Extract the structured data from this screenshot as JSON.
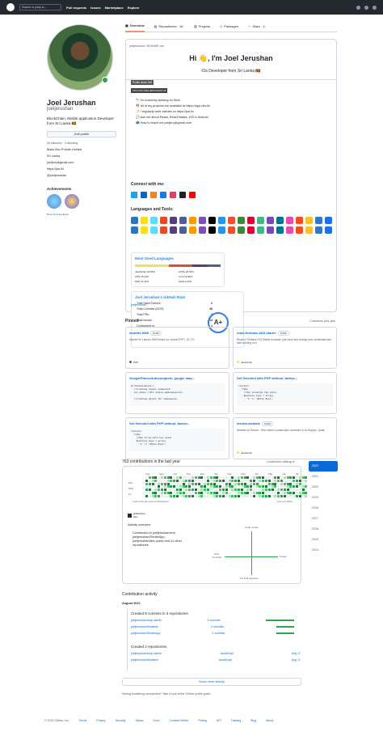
{
  "header": {
    "search_placeholder": "Search or jump to...",
    "nav": [
      "Pull requests",
      "Issues",
      "Marketplace",
      "Explore"
    ]
  },
  "tabs": [
    {
      "label": "Overview",
      "count": ""
    },
    {
      "label": "Repositories",
      "count": "78"
    },
    {
      "label": "Projects",
      "count": ""
    },
    {
      "label": "Packages",
      "count": ""
    },
    {
      "label": "Stars",
      "count": "7"
    }
  ],
  "profile": {
    "name": "Joel Jerushan",
    "username": "joeljerushan",
    "bio": "BlockChain, Mobile application Developer from Sri Lanka 🇱🇰",
    "edit_label": "Edit profile",
    "follow_text": "28 followers · 0 following",
    "details": [
      "Black Box Private Limited",
      "Sri Lanka",
      "joeljeru@gmail.com",
      "https://jse.lk/",
      "@joeljerushan"
    ],
    "achievements_title": "Achievements",
    "beta_text": "Beta  Send feedback"
  },
  "readme": {
    "path": "joeljerushan / README.md",
    "title": "Hi 👋, I'm Joel Jerushan",
    "subtitle": "iOs Developer from Sri Lanka 🇱🇰",
    "profile_views": "Profile views 318",
    "follow_badge": "FOLLOW JOELJERUSHAN 18",
    "bullets": [
      "🔭 I'm currently working on Slick",
      "👯 All of my projects are available at https://app-dev.lk/",
      "📝 I regularly write articles on https://jse.lk/",
      "💬 Ask me about React, React Native, iOS & Android",
      "📫 How to reach me joeljeru@gmail.com"
    ],
    "connect_title": "Connect with me:",
    "languages_title": "Languages and Tools:",
    "most_used": "Most Used Languages",
    "languages": [
      "JavaScript 40.96%",
      "HTML 26.64%",
      "CSS 18.23%",
      "Less 12.82%",
      "PHP 14.12%",
      "Hack 0.23%"
    ],
    "stats_title": "Joel Jerushan's GitHub Stats",
    "stats": [
      {
        "label": "Total Stars Earned:",
        "value": "2"
      },
      {
        "label": "Total Commits (2022):",
        "value": "26"
      },
      {
        "label": "Total PRs:",
        "value": "3"
      },
      {
        "label": "Total Issues:",
        "value": "14"
      },
      {
        "label": "Contributed to:",
        "value": "1"
      }
    ],
    "grade": "A+",
    "image_alt": "joeljerushan"
  },
  "pinned": {
    "title": "Pinned",
    "customize": "Customize your pins",
    "items": [
      {
        "title": "mobitel-SMS",
        "visibility": "Public",
        "desc": "Mobitel Sri Lanka's SMS library for Laravel PHP | JS | TS",
        "code": "",
        "lang": "PHP"
      },
      {
        "title": "react-firebase-iotS-starter",
        "visibility": "Public",
        "desc": "React & Firebase IOS Starter template, just clone and change your credentials and start working on it",
        "code": "",
        "lang": "JavaScript"
      },
      {
        "title": "GooglePlacesAutocomplete, google map...",
        "visibility": "",
        "desc": "",
        "code": "$('#placesInput').\n  //creating places component\n  let place = Rtl.statuc.addcomponents\n\n  //creating object for namespaces",
        "lang": ""
      },
      {
        "title": "Set Selected with PHP without Javasc...",
        "visibility": "",
        "desc": "",
        "code": "<select>\n  <?php\n    //Set selected tag value\n    $options_type = array(\n      '1' => 'White Rice',",
        "lang": ""
      },
      {
        "title": "Set Selected with PHP without Javasc...",
        "visibility": "",
        "desc": "",
        "code": "<select>\n  <?php\n    //Set Array with key value\n    $options_type = array(\n      '1' => 'White Rice',",
        "lang": ""
      },
      {
        "title": "electra-website",
        "visibility": "Public",
        "desc": "Website for Electra - Who interior construction contractor in Al-Rayyan, Qatar",
        "code": "",
        "lang": "JavaScript"
      }
    ]
  },
  "contributions": {
    "title": "763 contributions in the last year",
    "settings": "Contribution settings ▾",
    "months": [
      "Aug",
      "Sep",
      "Oct",
      "Nov",
      "Dec",
      "Jan",
      "Feb",
      "Mar",
      "Apr",
      "May",
      "Jun",
      "Jul"
    ],
    "days": [
      "Mon",
      "Wed",
      "Fri"
    ],
    "learn": "Learn how we count contributions",
    "less": "Less ▪▪▪▪ More",
    "org": "@blackbox-labs",
    "activity_overview": "Activity overview",
    "activity_text": "Contributed to joeljerushan/xmt, joeljerushan/ShrateApp, joeljerushan/site-public and 41 other repositories",
    "axis": {
      "top": "Code review",
      "left": "97% Commits",
      "right": "Issues",
      "bottom": "1% Pull requests"
    },
    "years": [
      "2022",
      "2021",
      "2020",
      "2019",
      "2018",
      "2017",
      "2016",
      "2015",
      "2014"
    ]
  },
  "activity": {
    "title": "Contribution activity",
    "month": "August 2022",
    "created_commits": "Created 8 commits in 3 repositories",
    "commit_repos": [
      {
        "name": "joeljerushan/shop-admin",
        "count": "4 commits"
      },
      {
        "name": "joeljerushan/thruklesh",
        "count": "2 commits"
      },
      {
        "name": "joeljerushan/ShrateApp",
        "count": "2 commits"
      }
    ],
    "created_repos": "Created 2 repositories",
    "new_repos": [
      {
        "name": "joeljerushan/shop-admin",
        "lang": "JavaScript",
        "date": "Aug 17"
      },
      {
        "name": "joeljerushan/thruklesh",
        "lang": "JavaScript",
        "date": "Aug 17"
      }
    ],
    "show_more": "Show more activity",
    "seeing": "Seeing something unexpected? Take a look at the GitHub profile guide."
  },
  "footer": {
    "copy": "© 2022 GitHub, Inc.",
    "links": [
      "Terms",
      "Privacy",
      "Security",
      "Status",
      "Docs",
      "Contact GitHub",
      "Pricing",
      "API",
      "Training",
      "Blog",
      "About"
    ]
  },
  "colors": {
    "accent": "#0969da",
    "green": "#2da44e",
    "orange": "#fd8c73"
  }
}
